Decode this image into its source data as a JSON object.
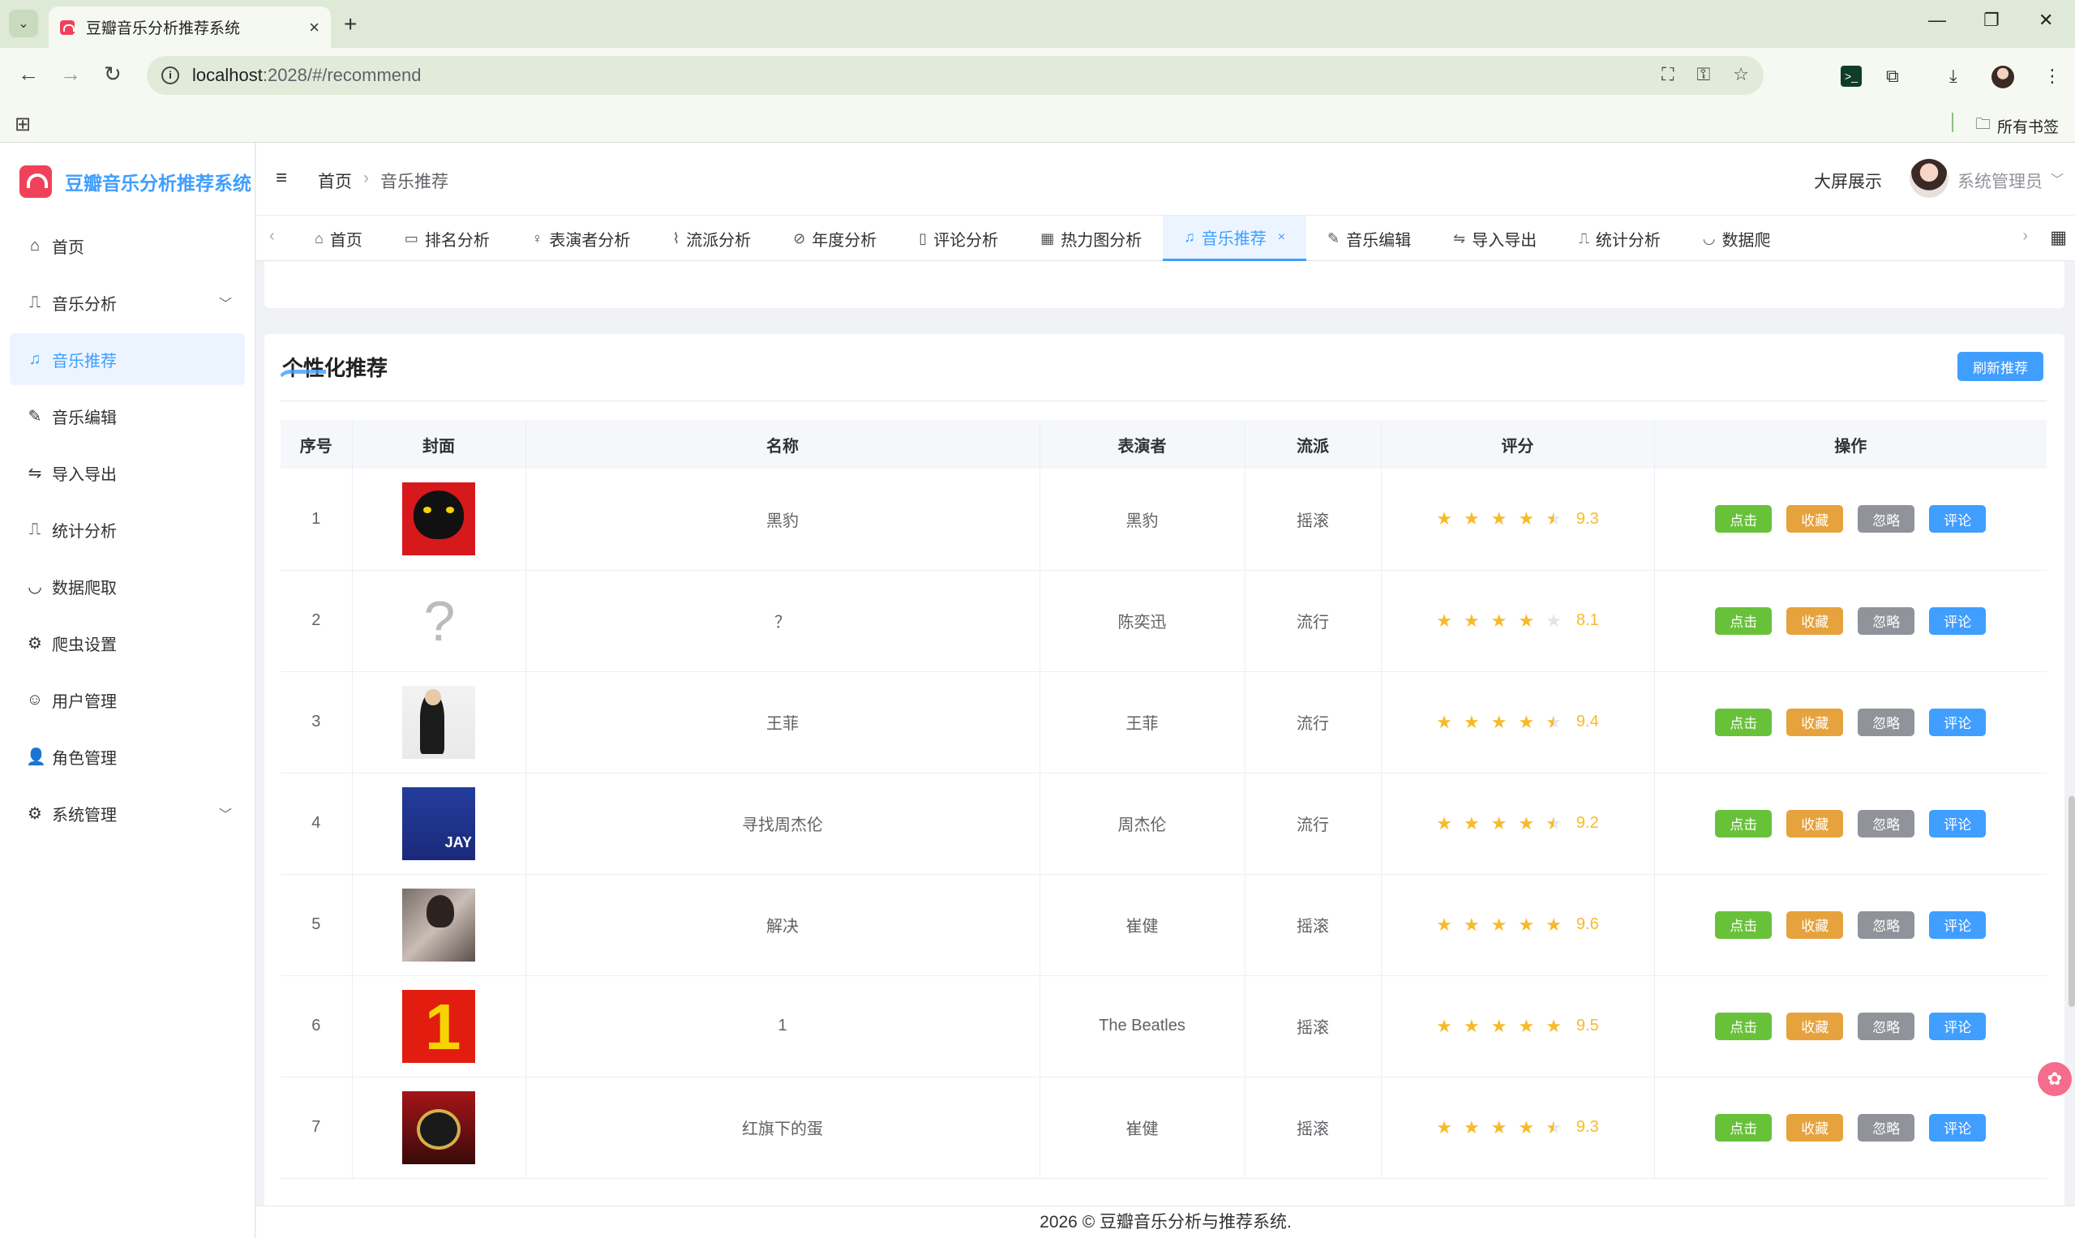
{
  "browser": {
    "tab_title": "豆瓣音乐分析推荐系统",
    "url_host": "localhost",
    "url_path": ":2028/#/recommend",
    "bookmarks_all": "所有书签"
  },
  "app": {
    "logo_text": "豆瓣音乐分析推荐系统",
    "sidebar": [
      {
        "label": "首页",
        "icon": "home-icon"
      },
      {
        "label": "音乐分析",
        "icon": "chart-board-icon"
      },
      {
        "label": "音乐推荐",
        "icon": "headphones-icon"
      },
      {
        "label": "音乐编辑",
        "icon": "edit-icon"
      },
      {
        "label": "导入导出",
        "icon": "switch-icon"
      },
      {
        "label": "统计分析",
        "icon": "chart-board-icon"
      },
      {
        "label": "数据爬取",
        "icon": "bowl-icon"
      },
      {
        "label": "爬虫设置",
        "icon": "gear-icon"
      },
      {
        "label": "用户管理",
        "icon": "user-icon"
      },
      {
        "label": "角色管理",
        "icon": "avatar-icon"
      },
      {
        "label": "系统管理",
        "icon": "gear-icon"
      }
    ],
    "breadcrumb": [
      "首页",
      "音乐推荐"
    ],
    "big_screen": "大屏展示",
    "user_name": "系统管理员",
    "tags": [
      {
        "label": "首页",
        "icon": "home-icon"
      },
      {
        "label": "排名分析",
        "icon": "folder-icon"
      },
      {
        "label": "表演者分析",
        "icon": "bulb-icon"
      },
      {
        "label": "流派分析",
        "icon": "paperclip-icon"
      },
      {
        "label": "年度分析",
        "icon": "compass-icon"
      },
      {
        "label": "评论分析",
        "icon": "book-icon"
      },
      {
        "label": "热力图分析",
        "icon": "grid-icon"
      },
      {
        "label": "音乐推荐",
        "icon": "headphones-icon"
      },
      {
        "label": "音乐编辑",
        "icon": "edit-icon"
      },
      {
        "label": "导入导出",
        "icon": "switch-icon"
      },
      {
        "label": "统计分析",
        "icon": "chart-board-icon"
      },
      {
        "label": "数据爬",
        "icon": "bowl-icon"
      }
    ],
    "card_title": "个性化推荐",
    "refresh_label": "刷新推荐",
    "columns": [
      "序号",
      "封面",
      "名称",
      "表演者",
      "流派",
      "评分",
      "操作"
    ],
    "op_labels": {
      "click": "点击",
      "fav": "收藏",
      "ignore": "忽略",
      "comment": "评论"
    },
    "rows": [
      {
        "idx": "1",
        "name": "黑豹",
        "artist": "黑豹",
        "genre": "摇滚",
        "score": "9.3",
        "stars": 4.5
      },
      {
        "idx": "2",
        "name": "？",
        "artist": "陈奕迅",
        "genre": "流行",
        "score": "8.1",
        "stars": 4
      },
      {
        "idx": "3",
        "name": "王菲",
        "artist": "王菲",
        "genre": "流行",
        "score": "9.4",
        "stars": 4.5
      },
      {
        "idx": "4",
        "name": "寻找周杰伦",
        "artist": "周杰伦",
        "genre": "流行",
        "score": "9.2",
        "stars": 4.5
      },
      {
        "idx": "5",
        "name": "解决",
        "artist": "崔健",
        "genre": "摇滚",
        "score": "9.6",
        "stars": 5
      },
      {
        "idx": "6",
        "name": "1",
        "artist": "The Beatles",
        "genre": "摇滚",
        "score": "9.5",
        "stars": 5
      },
      {
        "idx": "7",
        "name": "红旗下的蛋",
        "artist": "崔健",
        "genre": "摇滚",
        "score": "9.3",
        "stars": 4.5
      }
    ],
    "footer": "2026 © 豆瓣音乐分析与推荐系统."
  }
}
